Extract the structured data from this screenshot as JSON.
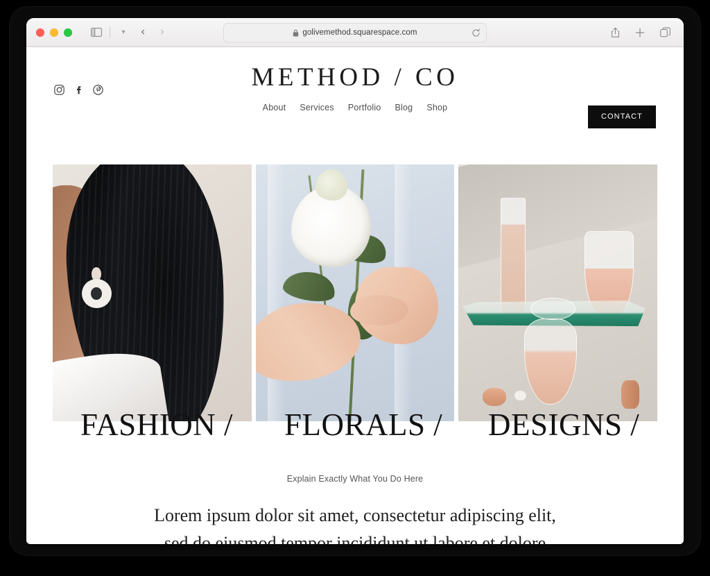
{
  "browser": {
    "window_controls": [
      "close",
      "minimize",
      "maximize"
    ],
    "sidebar_toggle_icon": "sidebar-icon",
    "tab_overview_icon": "chevron-down-icon",
    "back_icon": "chevron-left-icon",
    "forward_icon": "chevron-right-icon",
    "url": "golivemethod.squarespace.com",
    "lock_icon": "lock-icon",
    "reload_icon": "reload-icon",
    "share_icon": "share-icon",
    "new_tab_icon": "plus-icon",
    "tabs_icon": "tabs-icon"
  },
  "site": {
    "brand": "METHOD / CO",
    "contact_button": "CONTACT",
    "socials": [
      {
        "name": "instagram",
        "label": "Instagram"
      },
      {
        "name": "facebook",
        "label": "Facebook"
      },
      {
        "name": "pinterest",
        "label": "Pinterest"
      }
    ],
    "nav": [
      {
        "label": "About"
      },
      {
        "label": "Services"
      },
      {
        "label": "Portfolio"
      },
      {
        "label": "Blog"
      },
      {
        "label": "Shop"
      }
    ],
    "gallery": [
      {
        "caption": "FASHION /",
        "alt": "Woman in profile with long dark hair wearing a white circular hoop earring"
      },
      {
        "caption": "FLORALS /",
        "alt": "Hands holding white lisianthus flowers against a pale blue shirt"
      },
      {
        "caption": "DESIGNS /",
        "alt": "Glassware with rose-colored liquid on a green-edged glass shelf with macarons"
      }
    ],
    "copy": {
      "eyebrow": "Explain Exactly What You Do Here",
      "lede_line_1": "Lorem ipsum dolor sit amet, consectetur adipiscing elit,",
      "lede_line_2": "sed do eiusmod tempor incididunt ut labore et dolore"
    }
  },
  "colors": {
    "accent": "#0d0d0d",
    "page_bg": "#ffffff",
    "bezel": "#0b0b0b",
    "toolbar_bg": "#f2f0f0"
  }
}
